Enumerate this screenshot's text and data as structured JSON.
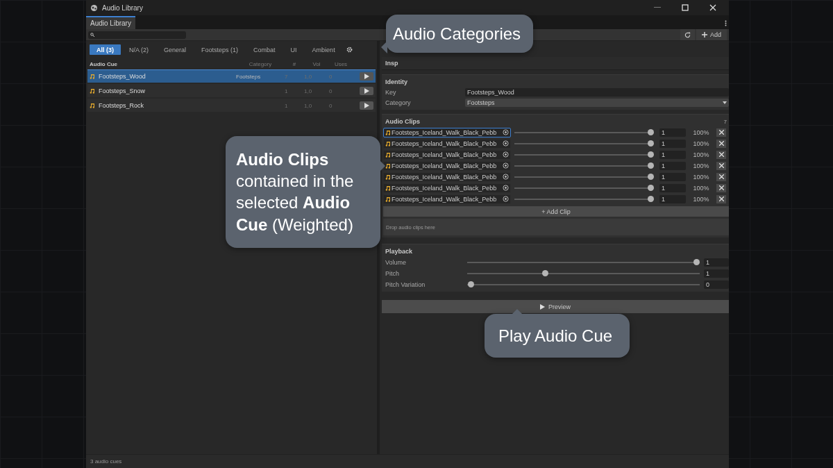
{
  "window": {
    "title": "Audio Library"
  },
  "tab": {
    "label": "Audio Library",
    "selected": true
  },
  "toolbar": {
    "add_label": "Add"
  },
  "categories": [
    {
      "label": "All (3)",
      "selected": true
    },
    {
      "label": "N/A (2)",
      "selected": false
    },
    {
      "label": "General",
      "selected": false
    },
    {
      "label": "Footsteps (1)",
      "selected": false
    },
    {
      "label": "Combat",
      "selected": false
    },
    {
      "label": "UI",
      "selected": false
    },
    {
      "label": "Ambient",
      "selected": false
    }
  ],
  "cue_table": {
    "columns": [
      "Audio Cue",
      "Category",
      "#",
      "Vol",
      "Uses"
    ],
    "rows": [
      {
        "name": "Footsteps_Wood",
        "category": "Footsteps",
        "count": "7",
        "vol": "1,0",
        "uses": "0",
        "selected": true
      },
      {
        "name": "Footsteps_Snow",
        "count": "1",
        "vol": "1,0",
        "uses": "0",
        "selected": false
      },
      {
        "name": "Footsteps_Rock",
        "count": "1",
        "vol": "1,0",
        "uses": "0",
        "selected": false
      }
    ]
  },
  "inspector": {
    "title": "Insp",
    "identity": {
      "title": "Identity",
      "key_label": "Key",
      "key_value": "Footsteps_Wood",
      "category_label": "Category",
      "category_value": "Footsteps"
    },
    "clips": {
      "title": "Audio Clips",
      "count": "7",
      "add_label": "+ Add Clip",
      "drop_hint": "Drop audio clips here",
      "items": [
        {
          "name": "Footsteps_Iceland_Walk_Black_Pebb",
          "level": 1,
          "weight": "1",
          "percent": "100%",
          "selected": true
        },
        {
          "name": "Footsteps_Iceland_Walk_Black_Pebb",
          "level": 1,
          "weight": "1",
          "percent": "100%",
          "selected": false
        },
        {
          "name": "Footsteps_Iceland_Walk_Black_Pebb",
          "level": 1,
          "weight": "1",
          "percent": "100%",
          "selected": false
        },
        {
          "name": "Footsteps_Iceland_Walk_Black_Pebb",
          "level": 1,
          "weight": "1",
          "percent": "100%",
          "selected": false
        },
        {
          "name": "Footsteps_Iceland_Walk_Black_Pebb",
          "level": 1,
          "weight": "1",
          "percent": "100%",
          "selected": false
        },
        {
          "name": "Footsteps_Iceland_Walk_Black_Pebb",
          "level": 1,
          "weight": "1",
          "percent": "100%",
          "selected": false
        },
        {
          "name": "Footsteps_Iceland_Walk_Black_Pebb",
          "level": 1,
          "weight": "1",
          "percent": "100%",
          "selected": false
        }
      ]
    },
    "playback": {
      "title": "Playback",
      "params": [
        {
          "label": "Volume",
          "level": 1,
          "value": "1"
        },
        {
          "label": "Pitch",
          "level": 0.33,
          "value": "1"
        },
        {
          "label": "Pitch Variation",
          "level": 0,
          "value": "0"
        }
      ]
    },
    "preview_label": "Preview"
  },
  "status_bar": "3 audio cues",
  "callouts": [
    {
      "text": "Audio Categories"
    },
    {
      "text": "**Audio Clips** contained in the selected **Audio Cue** (Weighted)"
    },
    {
      "text": "Play Audio Cue"
    }
  ]
}
